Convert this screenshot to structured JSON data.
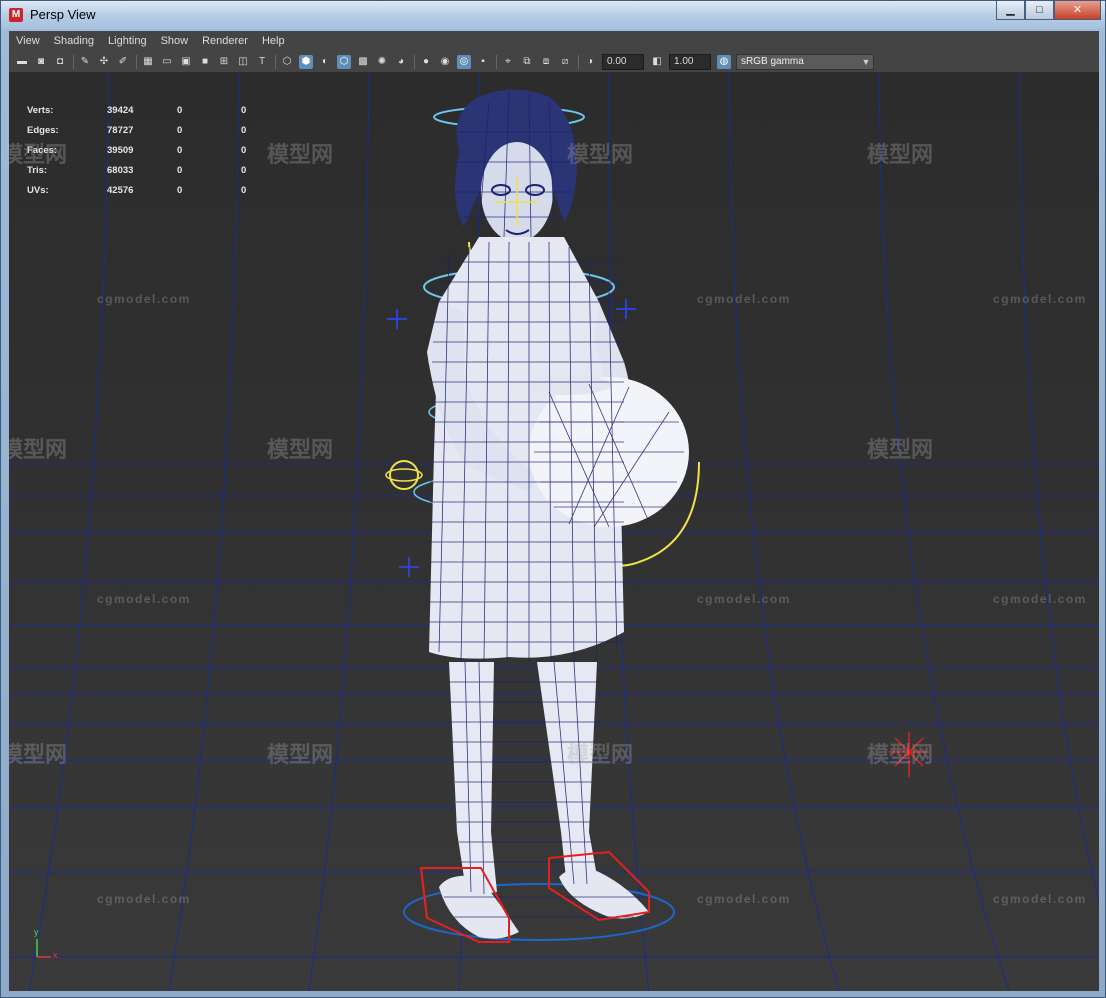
{
  "window": {
    "title": "Persp View",
    "app_icon_letter": "M",
    "minimize": "▁",
    "maximize": "□",
    "close": "✕"
  },
  "menu": [
    "View",
    "Shading",
    "Lighting",
    "Show",
    "Renderer",
    "Help"
  ],
  "toolbar": {
    "exposure_value": "0.00",
    "gamma_value": "1.00",
    "color_space": "sRGB gamma"
  },
  "hud": {
    "rows": [
      {
        "label": "Verts:",
        "v1": "39424",
        "v2": "0",
        "v3": "0"
      },
      {
        "label": "Edges:",
        "v1": "78727",
        "v2": "0",
        "v3": "0"
      },
      {
        "label": "Faces:",
        "v1": "39509",
        "v2": "0",
        "v3": "0"
      },
      {
        "label": "Tris:",
        "v1": "68033",
        "v2": "0",
        "v3": "0"
      },
      {
        "label": "UVs:",
        "v1": "42576",
        "v2": "0",
        "v3": "0"
      }
    ]
  },
  "watermark": {
    "site": "cgmodel.com",
    "cn": "模型网"
  },
  "axis": {
    "y": "y",
    "x": "x"
  },
  "colors": {
    "viewport_bg": "#2e2e2e",
    "grid": "#1a2a8a",
    "wire": "#1c2370",
    "mesh_fill": "#e9ecf5",
    "controller_blue": "#6ec7ef",
    "controller_yellow": "#f0e24a",
    "controller_red": "#e42020"
  }
}
